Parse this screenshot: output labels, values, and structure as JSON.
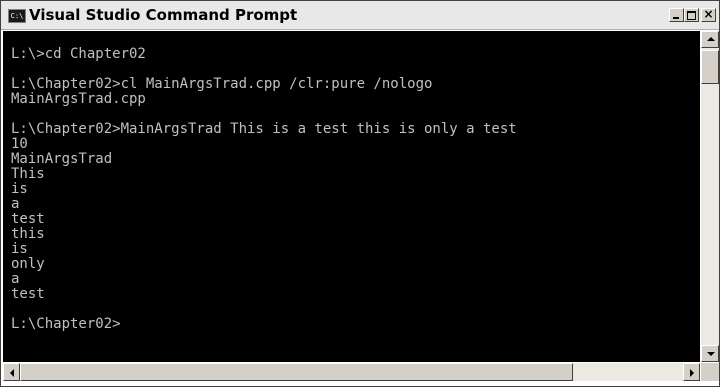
{
  "window": {
    "title": "Visual Studio Command Prompt",
    "icon_label": "C:\\",
    "icon": "console-icon",
    "controls": {
      "minimize_icon": "minimize-icon",
      "maximize_icon": "maximize-icon",
      "close_icon": "close-icon",
      "close_glyph": "×"
    }
  },
  "console": {
    "background": "#000000",
    "foreground": "#c0c0c0",
    "lines": [
      "L:\\>cd Chapter02",
      "",
      "L:\\Chapter02>cl MainArgsTrad.cpp /clr:pure /nologo",
      "MainArgsTrad.cpp",
      "",
      "L:\\Chapter02>MainArgsTrad This is a test this is only a test",
      "10",
      "MainArgsTrad",
      "This",
      "is",
      "a",
      "test",
      "this",
      "is",
      "only",
      "a",
      "test",
      "",
      "L:\\Chapter02>"
    ]
  },
  "scrollbars": {
    "vertical": {
      "up_icon": "arrow-up-icon",
      "down_icon": "arrow-down-icon",
      "position": 0
    },
    "horizontal": {
      "left_icon": "arrow-left-icon",
      "right_icon": "arrow-right-icon",
      "position": 0
    }
  }
}
